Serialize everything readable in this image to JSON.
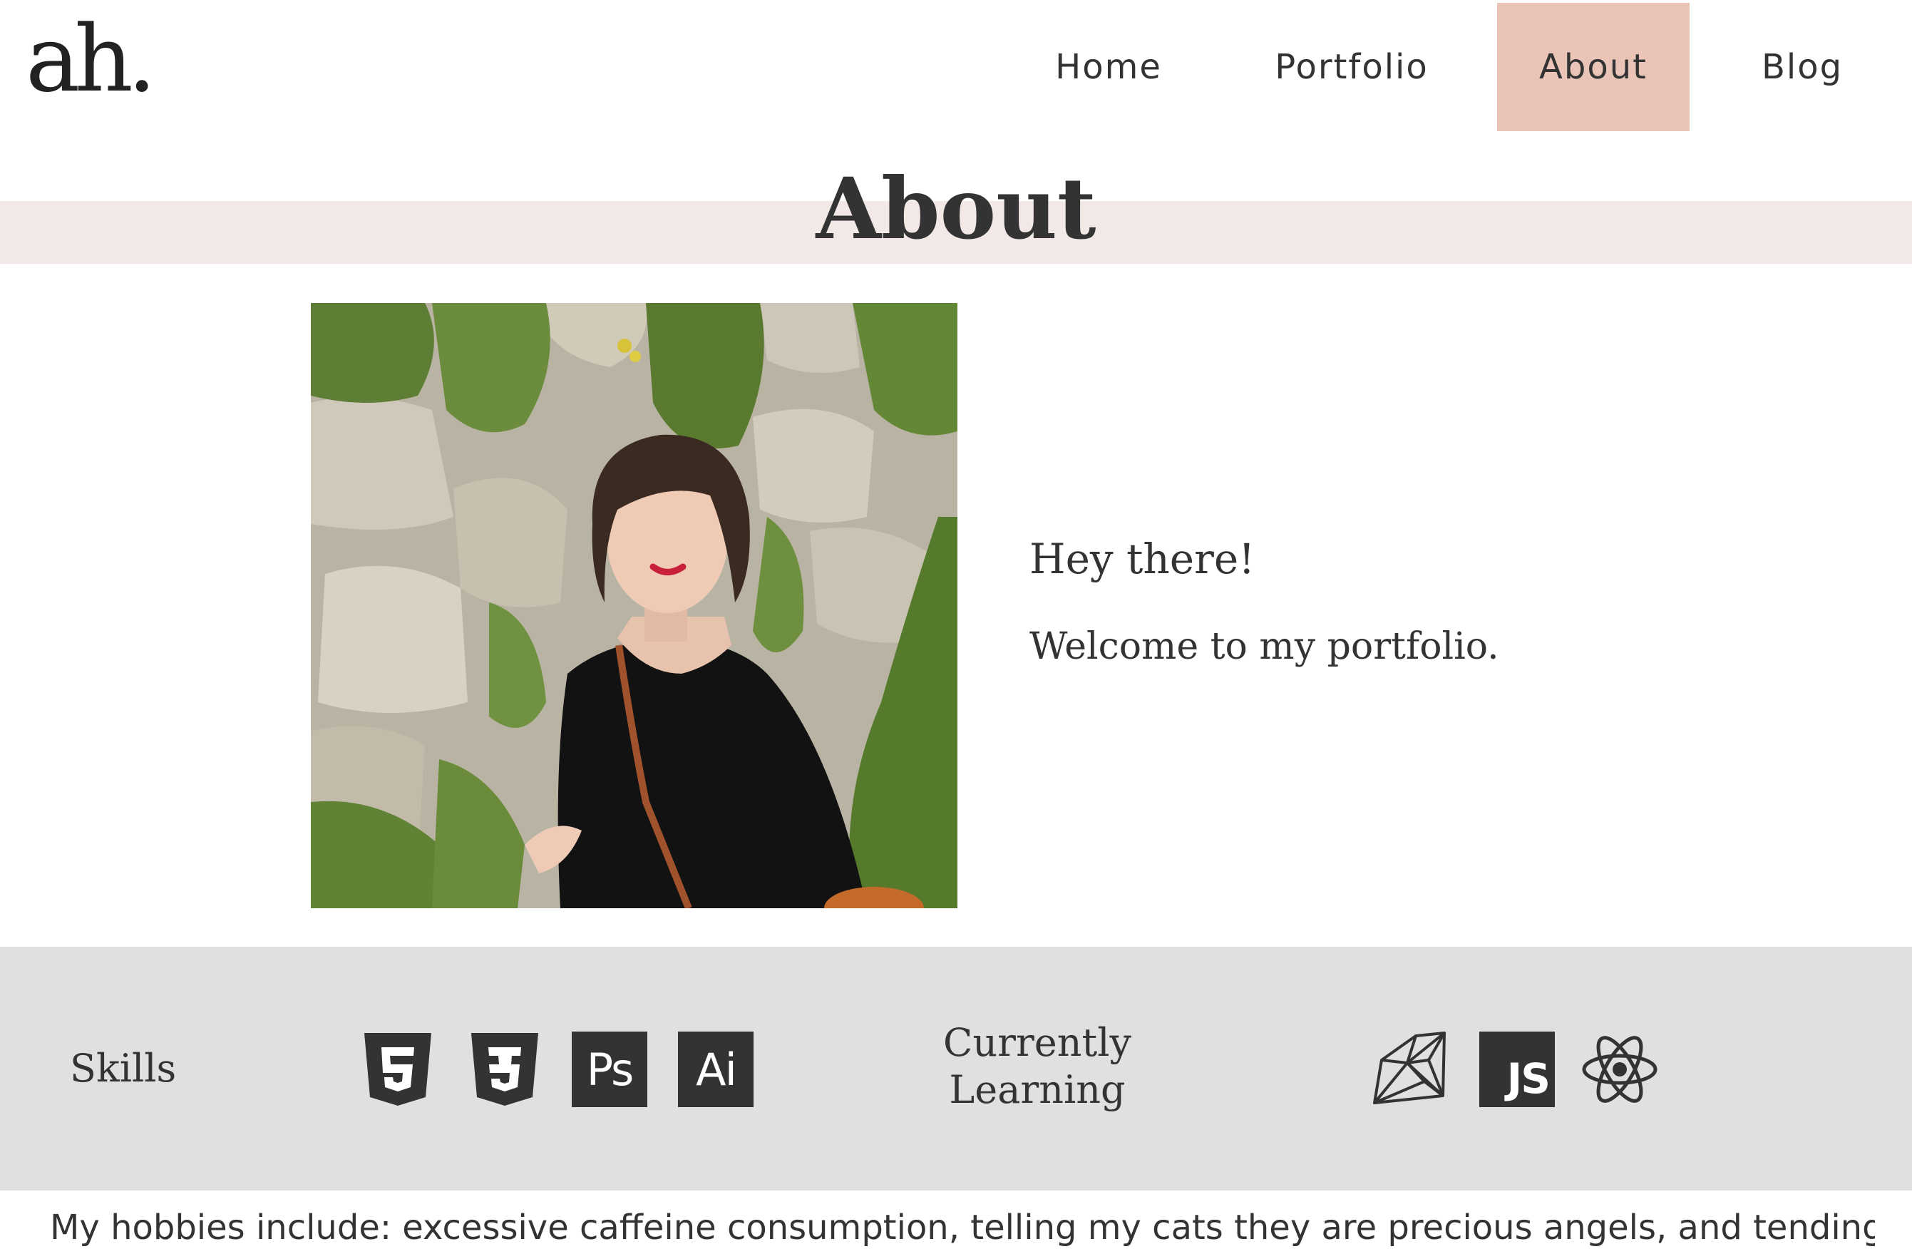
{
  "header": {
    "logo": "ah.",
    "nav": {
      "home": "Home",
      "portfolio": "Portfolio",
      "about": "About",
      "blog": "Blog"
    },
    "active_item": "About",
    "active_color": "#e9c4b7"
  },
  "about": {
    "title": "About",
    "band_color": "#f2e9e7",
    "greeting": "Hey there!",
    "welcome": "Welcome to my portfolio."
  },
  "skills": {
    "label": "Skills",
    "icons": [
      "html5-icon",
      "css3-icon",
      "photoshop-icon",
      "illustrator-icon"
    ],
    "ps_text": "Ps",
    "ai_text": "Ai",
    "band_color": "#e0e0e0"
  },
  "learning": {
    "label_line1": "Currently",
    "label_line2": "Learning",
    "icons": [
      "ruby-icon",
      "javascript-icon",
      "react-icon"
    ],
    "js_text": "JS"
  },
  "hobbies": {
    "text": "My hobbies include: excessive caffeine consumption, telling my cats they are precious angels, and tending to my"
  }
}
